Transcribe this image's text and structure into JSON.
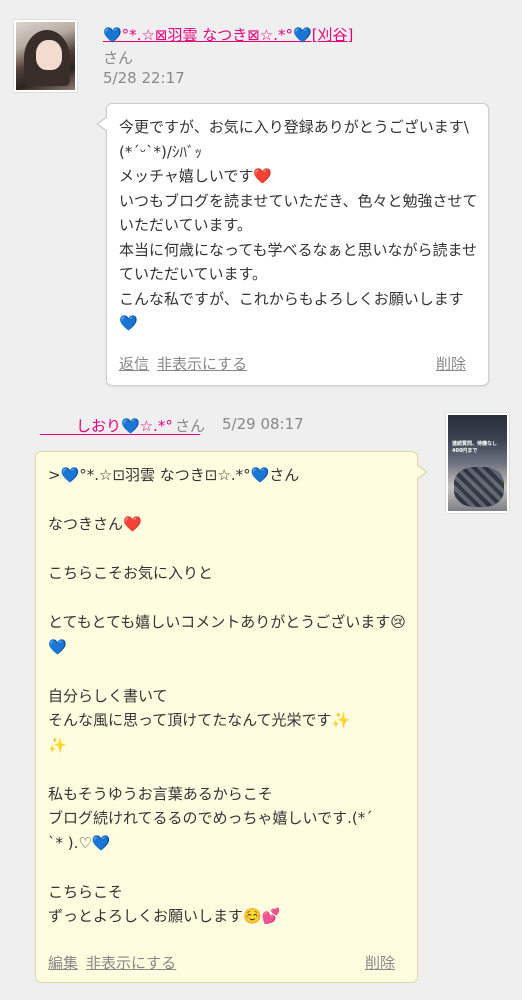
{
  "comment1": {
    "author": "💙°*.☆⊠羽雲 なつき⊠☆.*°💙[刈谷]",
    "suffix": "さん",
    "date": "5/28 22:17",
    "body": "今更ですが、お気に入り登録ありがとうございます\\(*´ᵕ`*)/ｼﾊﾞｯ\nメッチャ嬉しいです❤️\nいつもブログを読ませていただき、色々と勉強させていただいています。\n本当に何歳になっても学べるなぁと思いながら読ませていただいています。\nこんな私ですが、これからもよろしくお願いします💙",
    "actions": {
      "reply": "返信",
      "hide": "非表示にする",
      "delete": "削除"
    }
  },
  "comment2": {
    "author": "しおり💙☆.*°",
    "suffix": "さん",
    "date": "5/29 08:17",
    "body": ">💙°*.☆⊡羽雲 なつき⊡☆.*°💙さん\n\nなつきさん❤️\n\nこちらこそお気に入りと\n\nとてもとても嬉しいコメントありがとうございます😢💙\n\n自分らしく書いて\nそんな風に思って頂けてたなんて光栄です✨\n✨\n\n私もそうゆうお言葉あるからこそ\nブログ続けれてるるのでめっちゃ嬉しいです.(*ˊ\nˋ* ).♡💙\n\nこちらこそ\nずっとよろしくお願いします☺️💕",
    "actions": {
      "edit": "編集",
      "hide": "非表示にする",
      "delete": "削除"
    }
  },
  "avatar2_caption": "連続質問、待機なし 400円まで",
  "colors": {
    "background": "#efefef",
    "name_pink": "#e6007e",
    "bubble_yellow": "#fffde0",
    "muted": "#888888"
  }
}
